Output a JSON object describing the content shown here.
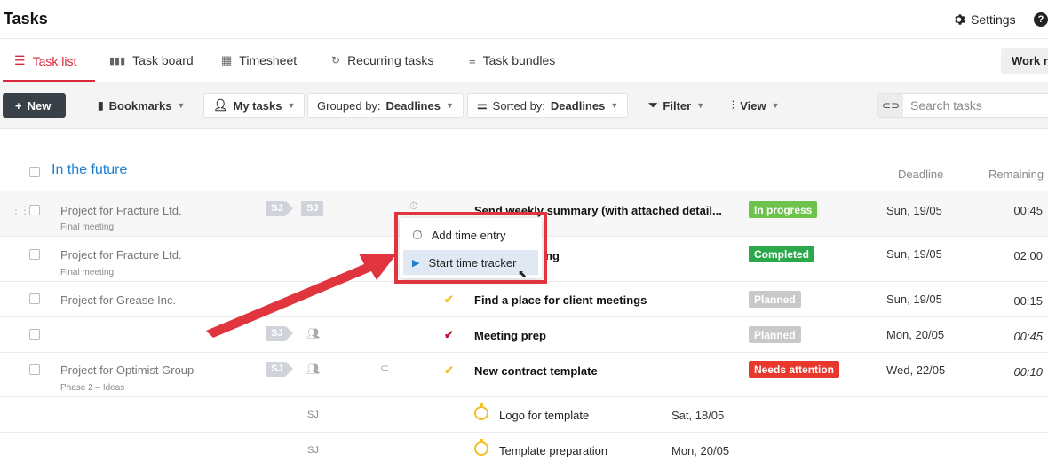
{
  "header": {
    "title": "Tasks",
    "settings_label": "Settings",
    "help_label": "?"
  },
  "tabs": [
    {
      "label": "Task list",
      "icon": "list-icon",
      "active": true
    },
    {
      "label": "Task board",
      "icon": "columns-icon"
    },
    {
      "label": "Timesheet",
      "icon": "grid-icon"
    },
    {
      "label": "Recurring tasks",
      "icon": "refresh-icon"
    },
    {
      "label": "Task bundles",
      "icon": "stack-icon"
    }
  ],
  "work_button": "Work r",
  "toolbar": {
    "new_label": "New",
    "bookmarks": "Bookmarks",
    "my_tasks": "My tasks",
    "grouped_prefix": "Grouped by:",
    "grouped_value": "Deadlines",
    "sorted_prefix": "Sorted by:",
    "sorted_value": "Deadlines",
    "filter": "Filter",
    "view": "View",
    "search_placeholder": "Search tasks"
  },
  "group": {
    "title": "In the future",
    "col_deadline": "Deadline",
    "col_remaining": "Remaining"
  },
  "rows": [
    {
      "project": "Project for Fracture Ltd.",
      "sub": "Final meeting",
      "tags": [
        "SJ",
        "SJ"
      ],
      "task": "Send weekly summary (with attached detail...",
      "status": "In progress",
      "deadline": "Sun, 19/05",
      "remaining": "00:45"
    },
    {
      "project": "Project for Fracture Ltd.",
      "sub": "Final meeting",
      "task": "ng",
      "status": "Completed",
      "deadline": "Sun, 19/05",
      "remaining": "02:00"
    },
    {
      "project": "Project for Grease Inc.",
      "task": "Find a place for client meetings",
      "status": "Planned",
      "deadline": "Sun, 19/05",
      "remaining": "00:15"
    },
    {
      "project": "",
      "tags": [
        "SJ"
      ],
      "task": "Meeting prep",
      "status": "Planned",
      "deadline": "Mon, 20/05",
      "remaining": "00:45"
    },
    {
      "project": "Project for Optimist Group",
      "sub": "Phase 2 – Ideas",
      "tags": [
        "SJ"
      ],
      "task": "New contract template",
      "status": "Needs attention",
      "deadline": "Wed, 22/05",
      "remaining": "00:10"
    }
  ],
  "subtasks": [
    {
      "assignee": "SJ",
      "task": "Logo for template",
      "date": "Sat, 18/05"
    },
    {
      "assignee": "SJ",
      "task": "Template preparation",
      "date": "Mon, 20/05"
    }
  ],
  "popup": {
    "add_time": "Add time entry",
    "start_tracker": "Start time tracker"
  },
  "colors": {
    "accent": "#d9263a",
    "link": "#1e7fcf",
    "in_progress": "#6cc24a",
    "completed": "#2aa84a",
    "planned": "#c9c9c9",
    "needs_attention": "#e8372c",
    "annotation": "#e0353f"
  }
}
